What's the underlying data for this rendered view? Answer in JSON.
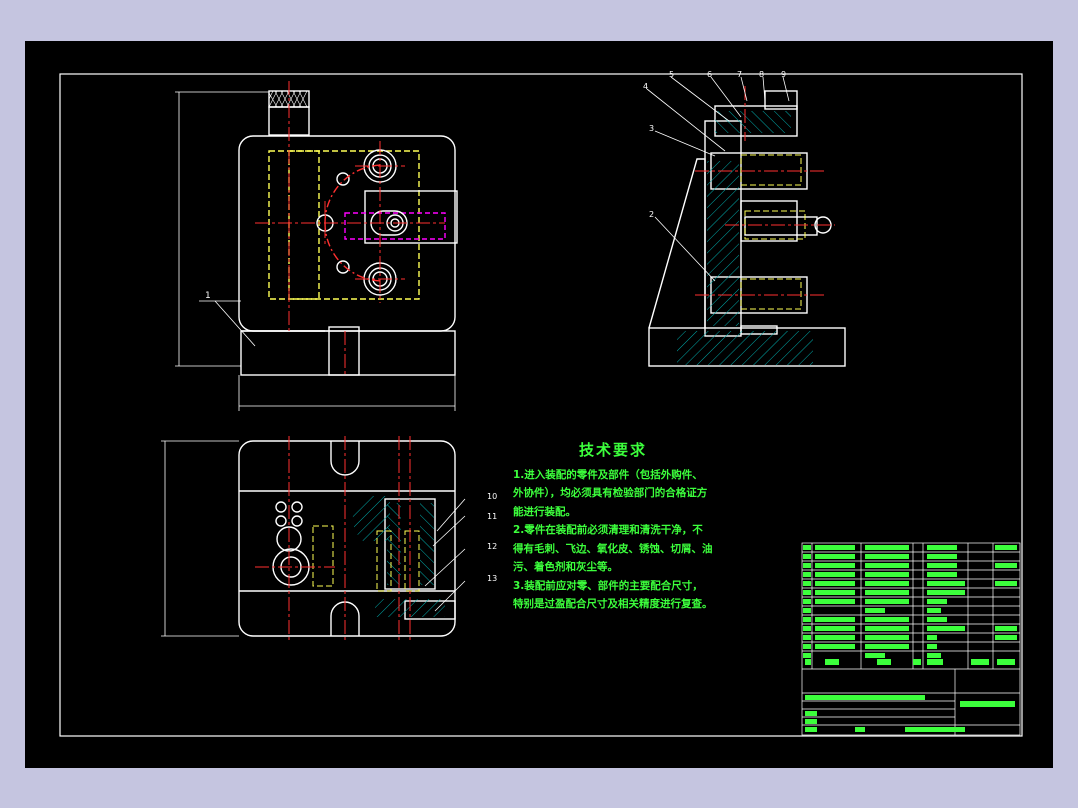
{
  "tech_requirements": {
    "title": "技术要求",
    "items": [
      "1.进入装配的零件及部件（包括外购件、外协件），均必须具有检验部门的合格证方能进行装配。",
      "2.零件在装配前必须清理和清洗干净，不得有毛刺、飞边、氧化皮、锈蚀、切屑、油污、着色剂和灰尘等。",
      "3.装配前应对零、部件的主要配合尺寸，特别是过盈配合尺寸及相关精度进行复查。"
    ]
  },
  "callouts": [
    "1",
    "4",
    "5",
    "6",
    "7",
    "8",
    "9",
    "3",
    "2",
    "10",
    "11",
    "12",
    "13"
  ],
  "colors": {
    "background": "#000000",
    "outline": "#ffffff",
    "center_line": "#ff3030",
    "hidden_line": "#ffff55",
    "hatch": "#00aaaa",
    "text": "#3cff3c",
    "dimension": "#ffffff"
  }
}
